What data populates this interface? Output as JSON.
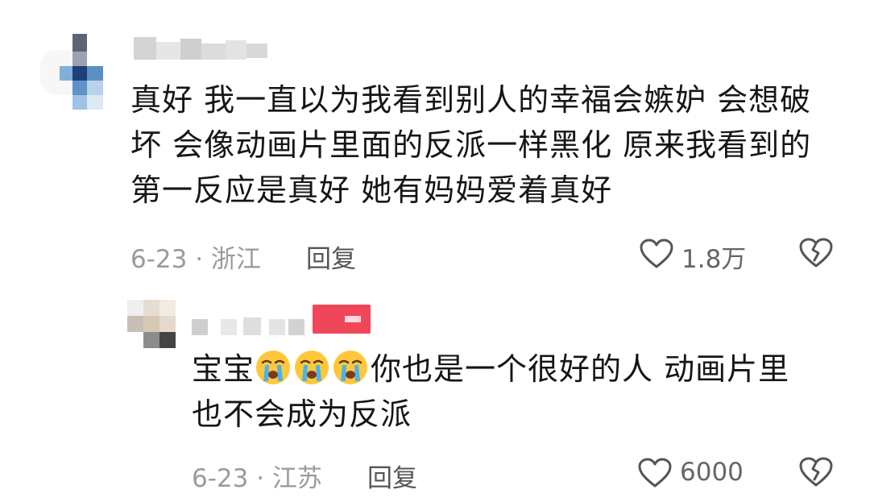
{
  "comment": {
    "text_lines": [
      "真好 我一直以为我看到别人的幸福会嫉妒 会想破",
      "坏 会像动画片里面的反派一样黑化 原来我看到的",
      "第一反应是真好 她有妈妈爱着真好"
    ],
    "date_location": "6-23 · 浙江",
    "reply_label": "回复",
    "like_count": "1.8万"
  },
  "reply": {
    "text_prefix": "宝宝",
    "text_line1_rest": "你也是一个很好的人 动画片里",
    "text_line2": "也不会成为反派",
    "date_location": "6-23 · 江苏",
    "reply_label": "回复",
    "like_count": "6000"
  },
  "icons": {
    "like": "heart-outline-icon",
    "dislike": "broken-heart-icon",
    "emoji": "loudly-crying-face-icon"
  },
  "colors": {
    "badge": "#f0465a",
    "text": "#161616",
    "meta": "#9b9b9b"
  }
}
